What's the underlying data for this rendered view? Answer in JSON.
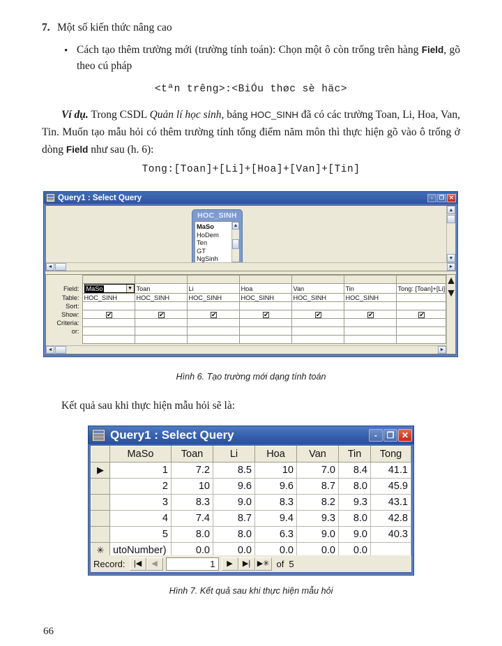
{
  "document": {
    "section_number": "7.",
    "section_title": "Một số kiến thức nâng cao",
    "bullet_part1": "Cách tạo thêm trường mới (trường tính toán): Chọn một ô còn trống trên hàng ",
    "bullet_bold": "Field",
    "bullet_part2": ", gõ theo cú pháp",
    "syntax_line": "<tªn tr­êng>:<BiÓu thøc sè häc>",
    "example_label": "Ví dụ.",
    "example_text1": " Trong CSDL ",
    "example_italic": "Quản lí học sinh",
    "example_text2": ", bảng ",
    "example_table": "HOC_SINH",
    "example_text3": " đã có các trường Toan, Li, Hoa, Van, Tin. Muốn tạo mẫu hỏi có thêm trường tính tổng điểm năm môn thì thực hiện gõ vào ô trống ở dòng ",
    "example_bold": "Field",
    "example_text4": " như sau (h. 6):",
    "expression_line": "Tong:[Toan]+[Li]+[Hoa]+[Van]+[Tin]",
    "caption_6": "Hình 6. Tạo trường mới dạng tính toán",
    "result_intro": "Kết quả sau khi thực hiện mẫu hỏi sẽ là:",
    "caption_7": "Hình 7. Kết quả sau khi thực hiện mẫu hỏi",
    "page_number": "66"
  },
  "design_window": {
    "title": "Query1 : Select Query",
    "icon": "query-design-icon",
    "minimize": "-",
    "restore": "❐",
    "close": "✕",
    "table_box": {
      "caption": "HOC_SINH",
      "fields": [
        "MaSo",
        "HoDem",
        "Ten",
        "GT",
        "NgSinh"
      ],
      "primary_key": "MaSo",
      "scroll_up": "▲",
      "scroll_down": "▼"
    },
    "scroll": {
      "left": "◄",
      "right": "►",
      "up": "▲",
      "down": "▼"
    },
    "grid": {
      "row_labels": [
        "Field:",
        "Table:",
        "Sort:",
        "Show:",
        "Criteria:",
        "or:"
      ],
      "field_row": [
        "MaSo",
        "Toan",
        "Li",
        "Hoa",
        "Van",
        "Tin",
        "Tong: [Toan]+[Li]+[Hoa]+[Van]+[Tin]"
      ],
      "selected_field": "MaSo",
      "dropdown_arrow": "▼",
      "table_row": [
        "HOC_SINH",
        "HOC_SINH",
        "HOC_SINH",
        "HOC_SINH",
        "HOC_SINH",
        "HOC_SINH",
        ""
      ],
      "sort_row": [
        "",
        "",
        "",
        "",
        "",
        "",
        ""
      ],
      "show_row": [
        true,
        true,
        true,
        true,
        true,
        true,
        true
      ],
      "criteria_row": [
        "",
        "",
        "",
        "",
        "",
        "",
        ""
      ],
      "or_row": [
        "",
        "",
        "",
        "",
        "",
        "",
        ""
      ]
    }
  },
  "result_window": {
    "title": "Query1 : Select Query",
    "icon": "datasheet-icon",
    "minimize": "-",
    "restore": "❐",
    "close": "✕",
    "datasheet": {
      "columns": [
        "MaSo",
        "Toan",
        "Li",
        "Hoa",
        "Van",
        "Tin",
        "Tong"
      ],
      "rows": [
        {
          "marker": "▶",
          "cells": [
            "1",
            "7.2",
            "8.5",
            "10",
            "7.0",
            "8.4",
            "41.1"
          ]
        },
        {
          "marker": "",
          "cells": [
            "2",
            "10",
            "9.6",
            "9.6",
            "8.7",
            "8.0",
            "45.9"
          ]
        },
        {
          "marker": "",
          "cells": [
            "3",
            "8.3",
            "9.0",
            "8.3",
            "8.2",
            "9.3",
            "43.1"
          ]
        },
        {
          "marker": "",
          "cells": [
            "4",
            "7.4",
            "8.7",
            "9.4",
            "9.3",
            "8.0",
            "42.8"
          ]
        },
        {
          "marker": "",
          "cells": [
            "5",
            "8.0",
            "8.0",
            "6.3",
            "9.0",
            "9.0",
            "40.3"
          ]
        }
      ],
      "new_row": {
        "marker": "✳",
        "cells": [
          "utoNumber)",
          "0.0",
          "0.0",
          "0.0",
          "0.0",
          "0.0",
          ""
        ]
      }
    },
    "navigation": {
      "label": "Record:",
      "first": "|◀",
      "prev": "◀",
      "current": "1",
      "next": "▶",
      "last": "▶|",
      "new": "▶✳",
      "of_label": "of",
      "total": "5"
    }
  },
  "colors": {
    "titlebar_blue": "#2e539b",
    "window_face": "#ece9d8",
    "table_box_blue": "#7e9bd0",
    "close_red": "#c4291c"
  }
}
